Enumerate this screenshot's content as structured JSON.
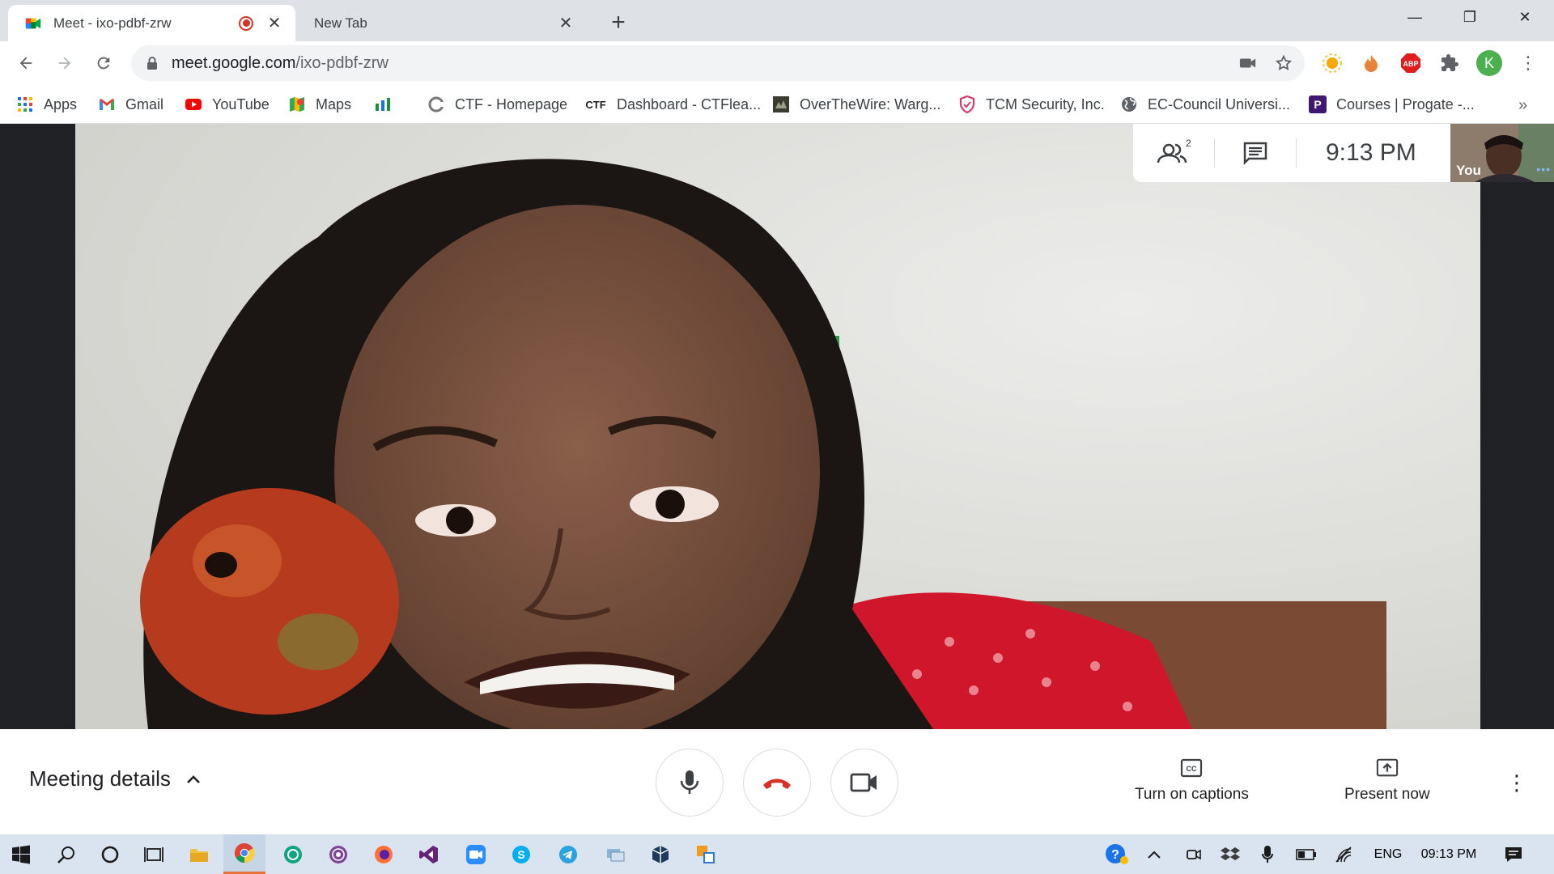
{
  "browser": {
    "tabs": [
      {
        "title": "Meet - ixo-pdbf-zrw",
        "active": true,
        "recording": true
      },
      {
        "title": "New Tab",
        "active": false
      }
    ],
    "new_tab_symbol": "+",
    "window_controls": {
      "minimize": "—",
      "restore": "❐",
      "close": "✕"
    },
    "address": {
      "host": "meet.google.com",
      "path": "/ixo-pdbf-zrw"
    },
    "profile_initial": "K",
    "extensions": [
      "sun-extension-icon",
      "fire-extension-icon",
      "adblock-plus-icon",
      "puzzle-extensions-icon"
    ],
    "adblock_label": "ABP"
  },
  "bookmarks": [
    {
      "label": "Apps",
      "icon": "apps-grid-icon"
    },
    {
      "label": "Gmail",
      "icon": "gmail-icon"
    },
    {
      "label": "YouTube",
      "icon": "youtube-icon"
    },
    {
      "label": "Maps",
      "icon": "maps-icon"
    },
    {
      "label": "",
      "icon": "analytics-icon"
    },
    {
      "label": "CTF - Homepage",
      "icon": "ctf-homepage-icon"
    },
    {
      "label": "Dashboard - CTFlea...",
      "icon": "ctf-dashboard-icon",
      "badge": "CTF"
    },
    {
      "label": "OverTheWire: Warg...",
      "icon": "overthewire-icon"
    },
    {
      "label": "TCM Security, Inc.",
      "icon": "shield-icon"
    },
    {
      "label": "EC-Council Universi...",
      "icon": "globe-icon"
    },
    {
      "label": "Courses | Progate -...",
      "icon": "progate-icon",
      "badge": "P"
    }
  ],
  "bookmarks_more": "»",
  "meet": {
    "participants_count": "2",
    "clock": "9:13 PM",
    "self_label": "You",
    "self_more": "•••",
    "meeting_details": "Meeting details",
    "captions_label": "Turn on captions",
    "present_label": "Present now",
    "captions_icon_text": "CC"
  },
  "taskbar": {
    "apps": [
      "windows-start-icon",
      "search-icon",
      "cortana-icon",
      "task-view-icon",
      "file-explorer-icon",
      "chrome-icon",
      "chatgpt-icon",
      "tor-icon",
      "firefox-icon",
      "visual-studio-icon",
      "zoom-icon",
      "skype-icon",
      "telegram-icon",
      "vm-icon",
      "virtualbox-icon",
      "remote-desktop-icon"
    ],
    "language": "ENG",
    "time": "09:13 PM"
  },
  "colors": {
    "accent_red": "#d93025",
    "meet_green": "#1e8e3e",
    "chrome_tabstrip": "#dee1e6"
  }
}
